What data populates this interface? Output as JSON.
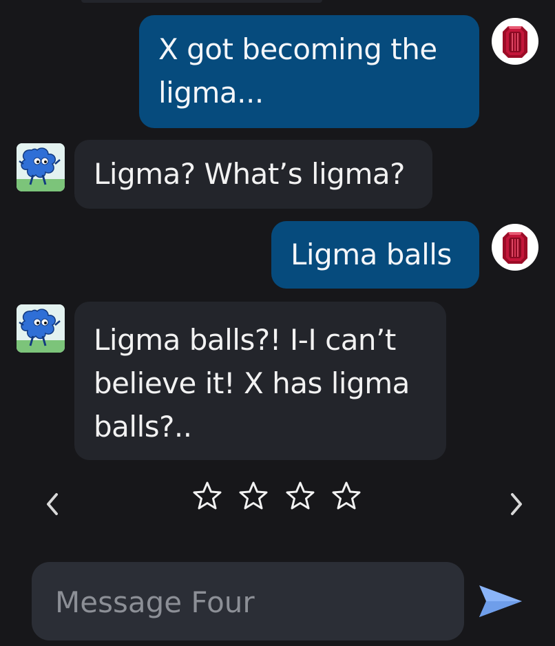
{
  "colors": {
    "background": "#17171a",
    "user_bubble": "#064b7d",
    "bot_bubble": "#23252b",
    "input_background": "#2b2e36",
    "send_accent": "#8ab4f8",
    "ruby": "#b0102e"
  },
  "messages": [
    {
      "sender": "user",
      "avatar": "ruby-gem-icon",
      "text": "X got becoming the ligma..."
    },
    {
      "sender": "bot",
      "avatar": "four-character-icon",
      "text": "Ligma? What’s ligma?"
    },
    {
      "sender": "user",
      "avatar": "ruby-gem-icon",
      "text": "Ligma balls"
    },
    {
      "sender": "bot",
      "avatar": "four-character-icon",
      "text": "Ligma balls?! I-I can’t believe it! X has ligma balls?.."
    }
  ],
  "rating": {
    "stars": 4,
    "selected": 0
  },
  "navigation": {
    "prev_icon": "chevron-left-icon",
    "next_icon": "chevron-right-icon"
  },
  "composer": {
    "placeholder": "Message Four",
    "value": "",
    "send_icon": "send-arrow-icon"
  }
}
